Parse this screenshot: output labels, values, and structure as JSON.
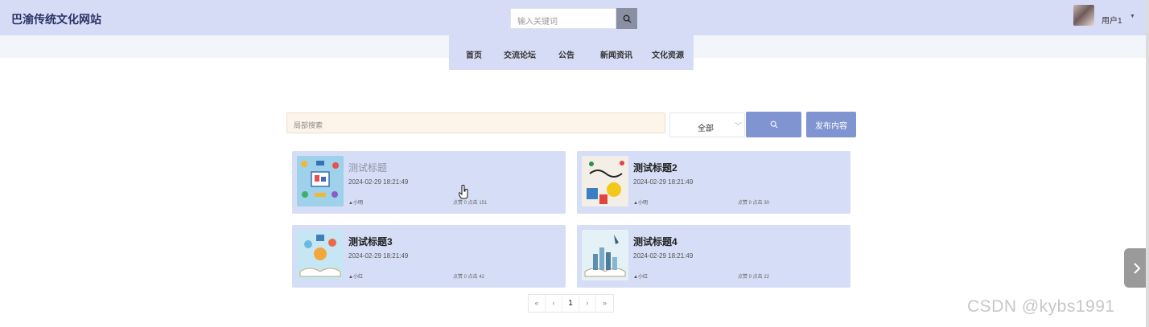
{
  "header": {
    "site_title": "巴渝传统文化网站",
    "search_placeholder": "输入关键词",
    "user_name": "用户1"
  },
  "nav": {
    "items": [
      {
        "label": "首页"
      },
      {
        "label": "交流论坛"
      },
      {
        "label": "公告"
      },
      {
        "label": "新闻资讯"
      },
      {
        "label": "文化资源"
      }
    ]
  },
  "toolbar": {
    "search_placeholder": "局部搜索",
    "category_value": "全部",
    "publish_label": "发布内容"
  },
  "posts": [
    {
      "title": "测试标题",
      "date": "2024-02-29 18:21:49",
      "author": "小明",
      "stats": "点赞 0 点击 151"
    },
    {
      "title": "测试标题2",
      "date": "2024-02-29 18:21:49",
      "author": "小明",
      "stats": "点赞 0 点击 30"
    },
    {
      "title": "测试标题3",
      "date": "2024-02-29 18:21:49",
      "author": "小红",
      "stats": "点赞 0 点击 42"
    },
    {
      "title": "测试标题4",
      "date": "2024-02-29 18:21:49",
      "author": "小红",
      "stats": "点赞 0 点击 22"
    }
  ],
  "pagination": {
    "first": "«",
    "prev": "‹",
    "current": "1",
    "next": "›",
    "last": "»"
  },
  "watermark": "CSDN @kybs1991",
  "colors": {
    "header_bg": "#d6dcf6",
    "card_bg": "#d6ddf6",
    "button_bg": "#7f94d0",
    "local_search_bg": "#fdf5e9"
  }
}
